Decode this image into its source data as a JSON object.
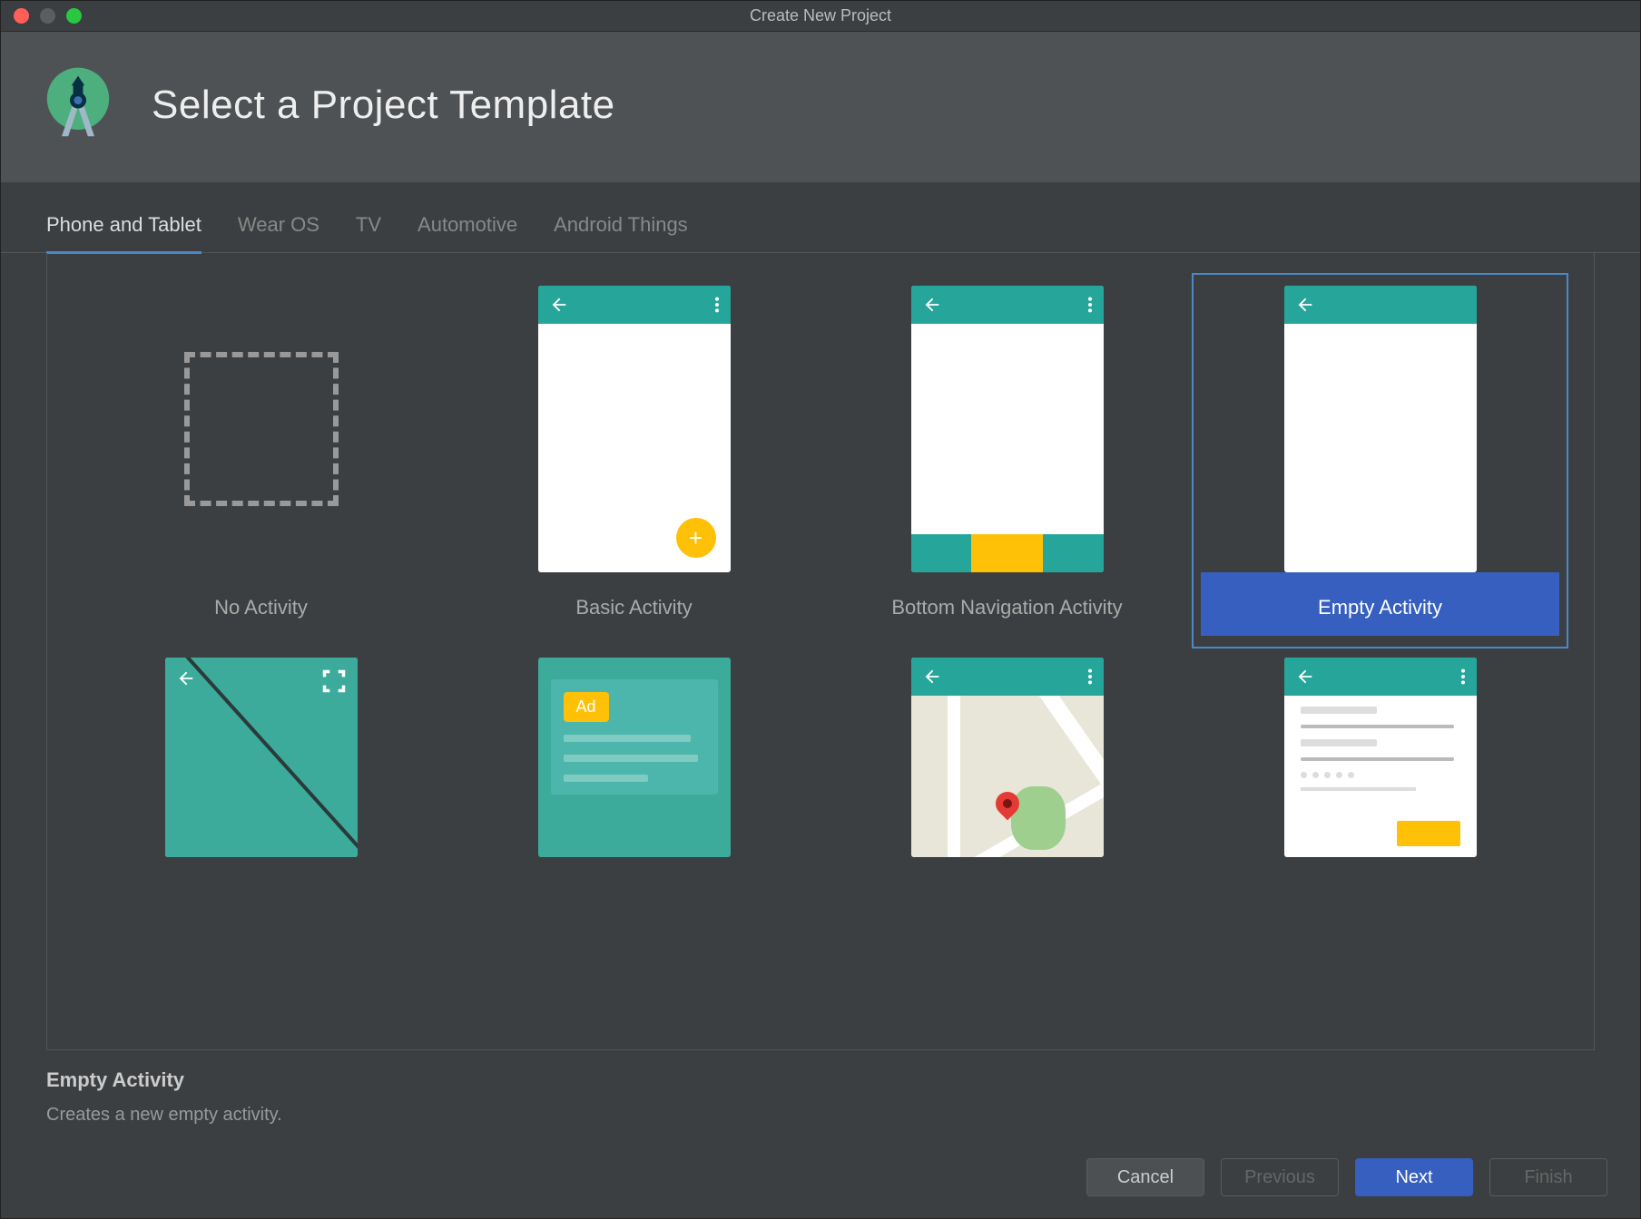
{
  "window": {
    "title": "Create New Project"
  },
  "header": {
    "title": "Select a Project Template"
  },
  "tabs": [
    {
      "label": "Phone and Tablet",
      "active": true
    },
    {
      "label": "Wear OS"
    },
    {
      "label": "TV"
    },
    {
      "label": "Automotive"
    },
    {
      "label": "Android Things"
    }
  ],
  "templates_row1": [
    {
      "label": "No Activity"
    },
    {
      "label": "Basic Activity"
    },
    {
      "label": "Bottom Navigation Activity"
    },
    {
      "label": "Empty Activity",
      "selected": true
    }
  ],
  "templates_row2_visible_partial": [
    {
      "kind": "fullscreen"
    },
    {
      "kind": "admob"
    },
    {
      "kind": "maps"
    },
    {
      "kind": "login"
    }
  ],
  "selection": {
    "name": "Empty Activity",
    "description": "Creates a new empty activity."
  },
  "ad_badge": "Ad",
  "buttons": {
    "cancel": "Cancel",
    "previous": "Previous",
    "next": "Next",
    "finish": "Finish"
  },
  "colors": {
    "accent": "#4a88c7",
    "primary_teal": "#26a69a",
    "fab_yellow": "#ffc107",
    "selected_blue": "#365fbf"
  }
}
